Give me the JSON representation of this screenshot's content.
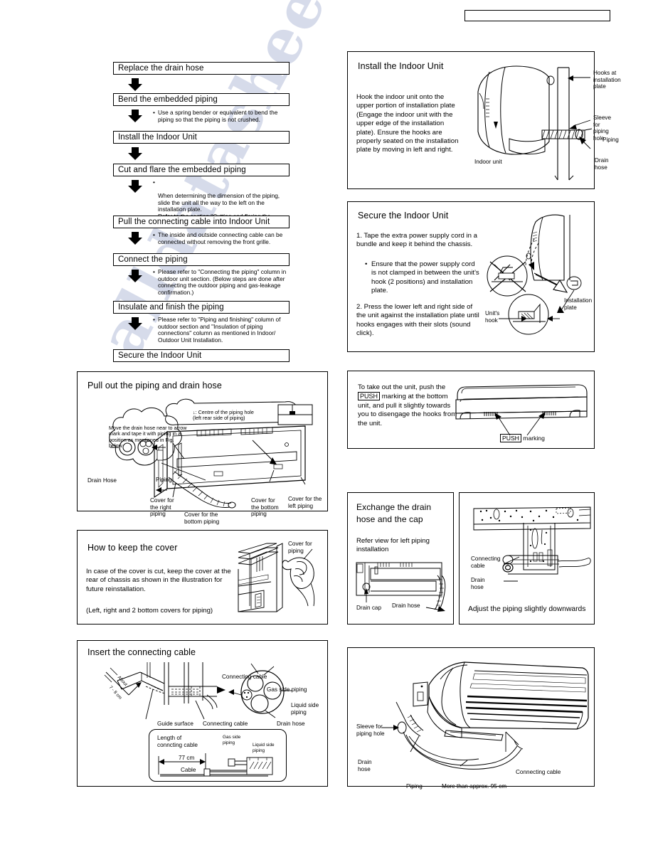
{
  "page": {
    "header_box_label": "",
    "watermark": "alldatasheet.com"
  },
  "flowchart": {
    "name": "indoor-unit-installation-flow",
    "steps": [
      {
        "title": "Replace the drain hose",
        "note": ""
      },
      {
        "title": "Bend the embedded piping",
        "note": "Use a spring bender or equivalent to bend the piping so that the piping is not crushed."
      },
      {
        "title": "Install the Indoor Unit",
        "note": ""
      },
      {
        "title": "Cut and flare the embedded piping",
        "note": "When determining the dimension of the piping, slide the unit all the way to the left on the installation plate.\nRefer to the section \"Cutting and flaring the piping\"."
      },
      {
        "title": "Pull the connecting cable into Indoor Unit",
        "note": "The inside and outside connecting cable can be connected without removing the front grille."
      },
      {
        "title": "Connect the piping",
        "note": "Please refer to \"Connecting the piping\" column in outdoor unit section. (Below steps are done after connecting the outdoor piping and gas-leakage confirmation.)"
      },
      {
        "title": "Insulate and finish the piping",
        "note": "Please refer to \"Piping and finishing\" column of outdoor section and \"Insulation of piping connections\" column as mentioned in Indoor/ Outdoor Unit Installation."
      },
      {
        "title": "Secure the Indoor Unit",
        "note": ""
      }
    ]
  },
  "panels": {
    "install_indoor_unit": {
      "title": "Install the Indoor Unit",
      "body": "Hook the indoor unit onto the upper portion of installation plate (Engage the indoor unit with the upper edge of the installation plate). Ensure the hooks are properly seated on the installation plate by moving in left and right.",
      "callouts": {
        "hooks": "Hooks at\ninstallation\nplate",
        "sleeve": "Sleeve for\npiping hole",
        "piping": "Piping",
        "drain_hose": "Drain hose",
        "indoor_unit": "Indoor unit"
      }
    },
    "secure_indoor_unit": {
      "title": "Secure the Indoor Unit",
      "step1": "1. Tape the extra power supply cord in a bundle and keep it behind the chassis.",
      "step1_bullet": "Ensure that the power supply cord is not clamped in between the unit's hook (2 positions) and installation plate.",
      "step2": "2. Press the lower left and right side of the unit against the installation plate until hooks engages with their slots (sound click).",
      "callouts": {
        "installation_plate": "Installation\nplate",
        "units_hook": "Unit's\nhook"
      }
    },
    "push_marking": {
      "body_pre": "To take out the unit, push the",
      "boxed": "PUSH",
      "body_post": "marking at the bottom unit, and pull it slightly towards you to disengage the hooks from the unit.",
      "callout_boxed": "PUSH",
      "callout_text": "marking"
    },
    "exchange_drain_hose": {
      "title": "Exchange the drain\nhose and the cap",
      "subtitle": "Refer view for left piping installation",
      "callouts": {
        "drain_cap": "Drain cap",
        "drain_hose": "Drain hose"
      }
    },
    "adjust_piping": {
      "caption": "Adjust the piping slightly downwards",
      "callouts": {
        "connecting_cable": "Connecting\ncable",
        "drain_hose": "Drain\nhose"
      }
    },
    "pull_out_piping": {
      "title": "Pull out the piping and drain hose",
      "cloud_note": "Move the drain hose near to arrow mark and tape it with piping in a position as mentioned in Fig. below",
      "centre_note": "↓: Centre of the piping hole\n(left rear side of piping)",
      "callouts": {
        "drain_hose": "Drain Hose",
        "piping": "Piping",
        "cover_right": "Cover for\nthe right\npiping",
        "cover_bottom": "Cover for the\nbottom piping",
        "cover_bottom2": "Cover for\nthe bottom\npiping",
        "cover_left": "Cover for the\nleft piping"
      }
    },
    "keep_cover": {
      "title": "How to keep the cover",
      "body": "In case of the cover is cut, keep the cover at the rear of chassis as shown in the illustration for future reinstallation.",
      "footnote": "(Left, right and 2 bottom covers for piping)",
      "callout": "Cover for piping"
    },
    "insert_connecting_cable": {
      "title": "Insert the connecting cable",
      "callouts": {
        "about": "About",
        "dimension": "7 - 8 cm",
        "guide_surface": "Guide surface",
        "connecting_cable": "Connecting cable",
        "connecting_cable2": "Connecting cable",
        "gas_side_piping": "Gas side piping",
        "liquid_side_piping": "Liquid side\npiping",
        "drain_hose": "Drain hose"
      },
      "detail_box": {
        "length_label": "Length of\nconncting cable",
        "length_value": "77 cm",
        "cable_label": "Cable",
        "gas_side": "Gas side\npiping",
        "liquid_side": "Liquid side\npiping"
      }
    },
    "final_assembly": {
      "callouts": {
        "sleeve": "Sleeve for\npiping hole",
        "drain_hose": "Drain\nhose",
        "piping": "Piping",
        "distance": "More than approx. 95 cm",
        "connecting_cable": "Connecting cable"
      }
    }
  }
}
